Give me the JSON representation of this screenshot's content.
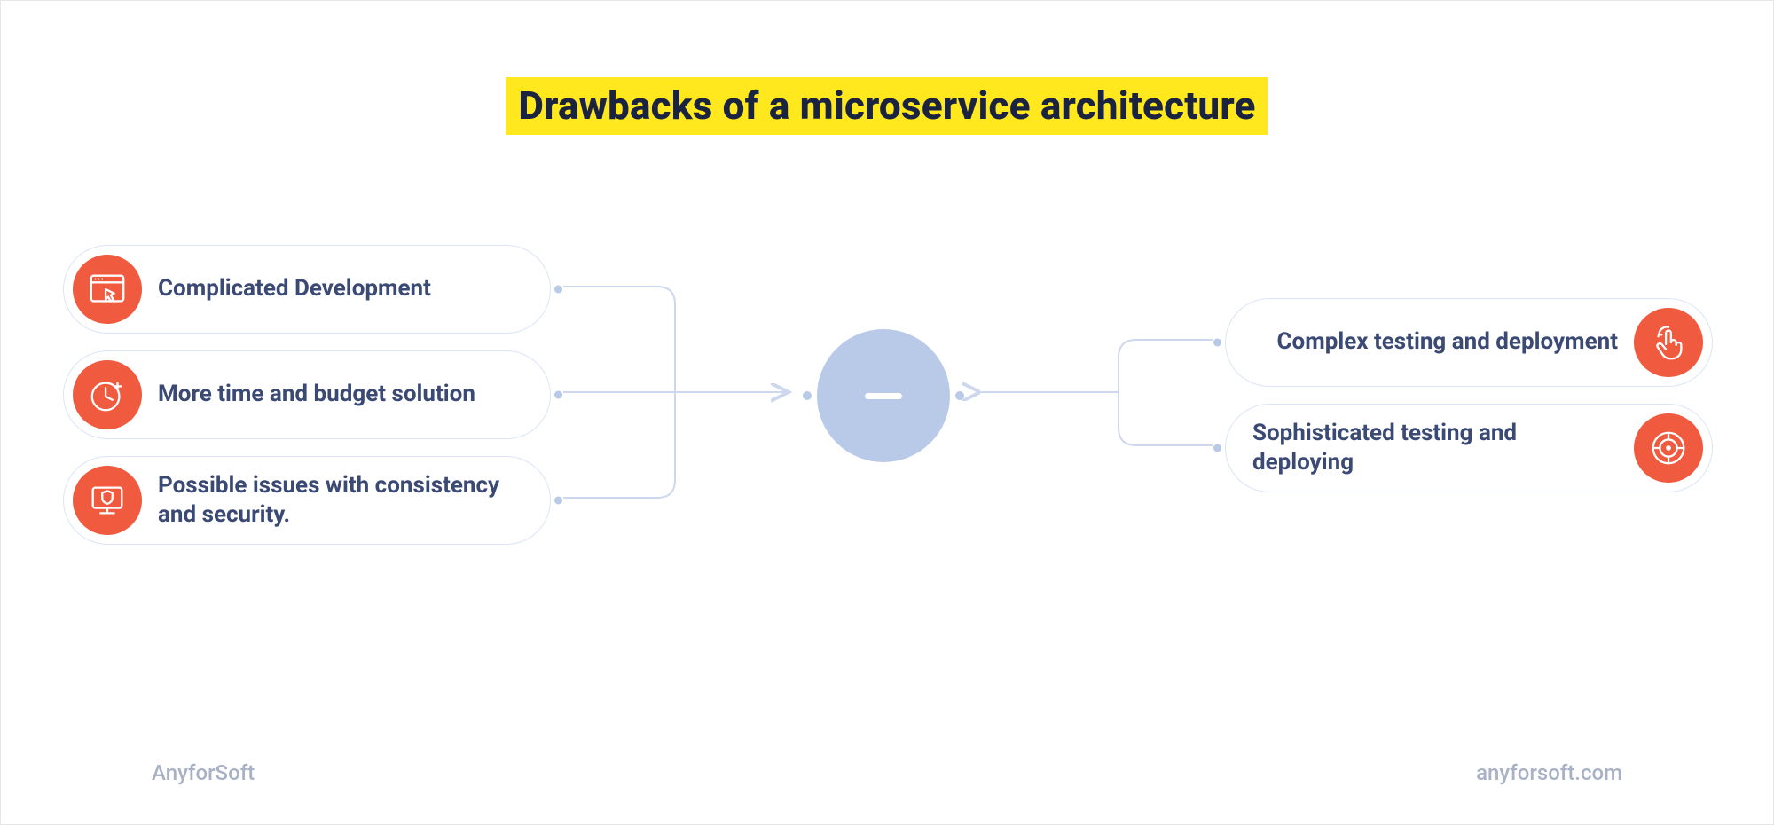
{
  "title": "Drawbacks of a microservice architecture",
  "center_symbol": "minus",
  "leftItems": [
    {
      "label": "Complicated Development",
      "icon": "browser-cursor-icon"
    },
    {
      "label": "More time and budget solution",
      "icon": "clock-plus-icon"
    },
    {
      "label": "Possible issues with consistency and security.",
      "icon": "monitor-shield-icon"
    }
  ],
  "rightItems": [
    {
      "label": "Complex testing and deployment",
      "icon": "touch-gesture-icon"
    },
    {
      "label": "Sophisticated testing and deploying",
      "icon": "vault-target-icon"
    }
  ],
  "footer": {
    "brand": "AnyforSoft",
    "site": "anyforsoft.com"
  },
  "colors": {
    "accent": "#f05a3f",
    "highlight": "#ffe81d",
    "centerCircle": "#b9c9e8",
    "text": "#3b4a74",
    "connector": "#cdd8ee",
    "pillBorder": "#dbe4f6",
    "muted": "#a9b1c6"
  }
}
